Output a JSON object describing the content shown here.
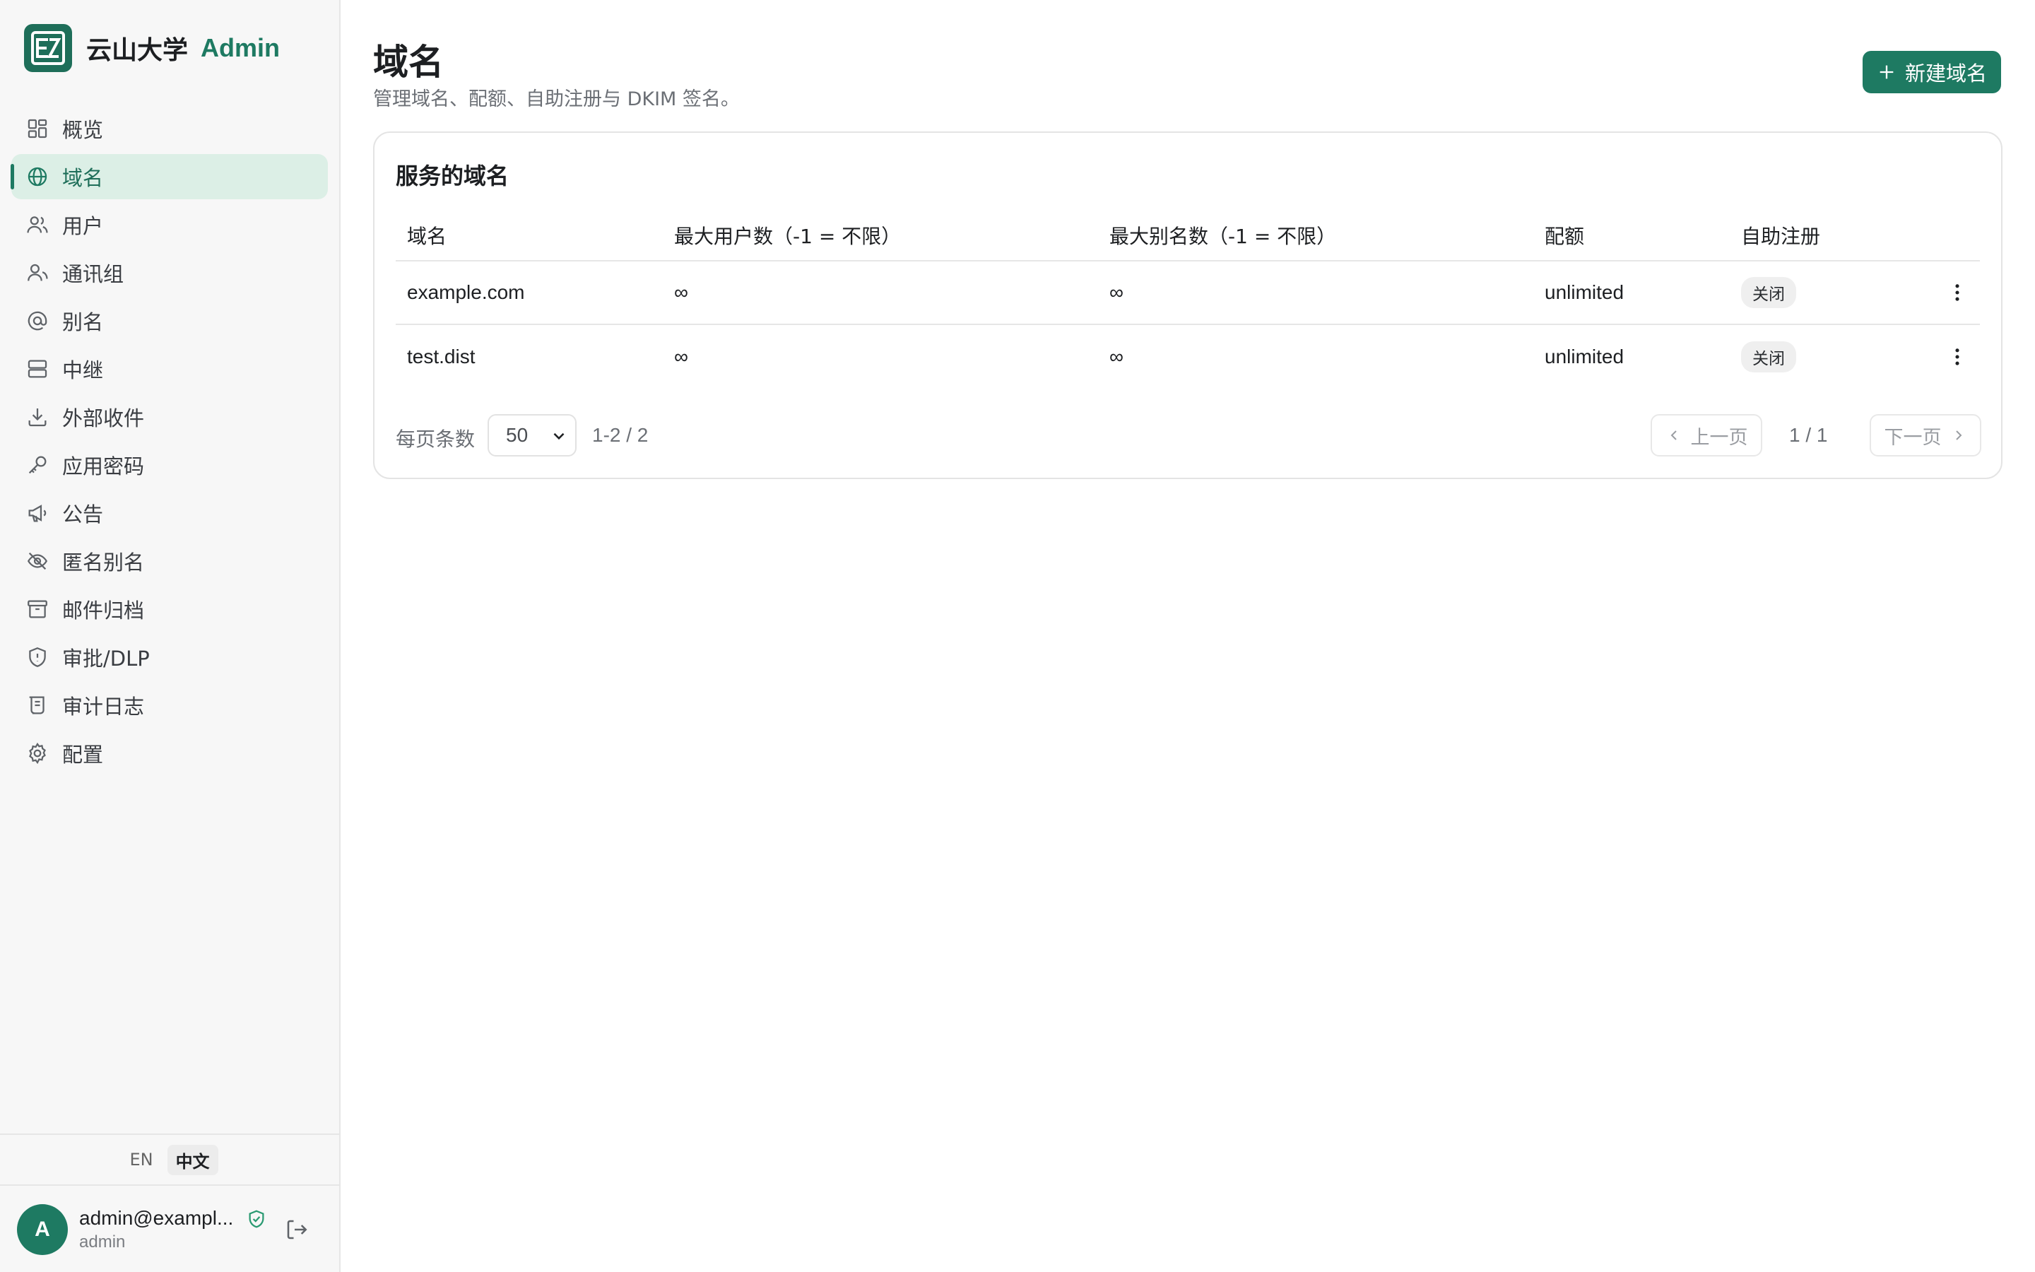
{
  "brand": {
    "name": "云山大学",
    "suffix": "Admin",
    "logo_text": "EZ"
  },
  "colors": {
    "accent": "#1e7a62",
    "active_bg": "#dcefe6"
  },
  "sidebar": {
    "items": [
      {
        "label": "概览",
        "icon": "dashboard-icon"
      },
      {
        "label": "域名",
        "icon": "globe-icon",
        "active": true
      },
      {
        "label": "用户",
        "icon": "users-icon"
      },
      {
        "label": "通讯组",
        "icon": "group-icon"
      },
      {
        "label": "别名",
        "icon": "at-icon"
      },
      {
        "label": "中继",
        "icon": "server-icon"
      },
      {
        "label": "外部收件",
        "icon": "download-icon"
      },
      {
        "label": "应用密码",
        "icon": "key-icon"
      },
      {
        "label": "公告",
        "icon": "megaphone-icon"
      },
      {
        "label": "匿名别名",
        "icon": "eye-off-icon"
      },
      {
        "label": "邮件归档",
        "icon": "archive-icon"
      },
      {
        "label": "审批/DLP",
        "icon": "shield-icon"
      },
      {
        "label": "审计日志",
        "icon": "scroll-icon"
      },
      {
        "label": "配置",
        "icon": "gear-icon"
      }
    ]
  },
  "language": {
    "options": [
      "EN",
      "中文"
    ],
    "selected": "中文"
  },
  "user": {
    "email": "admin@exampl...",
    "role": "admin",
    "avatar_initial": "A"
  },
  "header": {
    "title": "域名",
    "subtitle": "管理域名、配额、自助注册与 DKIM 签名。",
    "new_button": "新建域名"
  },
  "card": {
    "title": "服务的域名",
    "columns": [
      "域名",
      "最大用户数（-1 = 不限）",
      "最大别名数（-1 = 不限）",
      "配额",
      "自助注册"
    ],
    "rows": [
      {
        "domain": "example.com",
        "max_users": "∞",
        "max_aliases": "∞",
        "quota": "unlimited",
        "self_signup": "关闭"
      },
      {
        "domain": "test.dist",
        "max_users": "∞",
        "max_aliases": "∞",
        "quota": "unlimited",
        "self_signup": "关闭"
      }
    ]
  },
  "pagination": {
    "per_page_label": "每页条数",
    "per_page_value": "50",
    "range": "1-2 / 2",
    "prev": "上一页",
    "next": "下一页",
    "page_indicator": "1 / 1"
  }
}
